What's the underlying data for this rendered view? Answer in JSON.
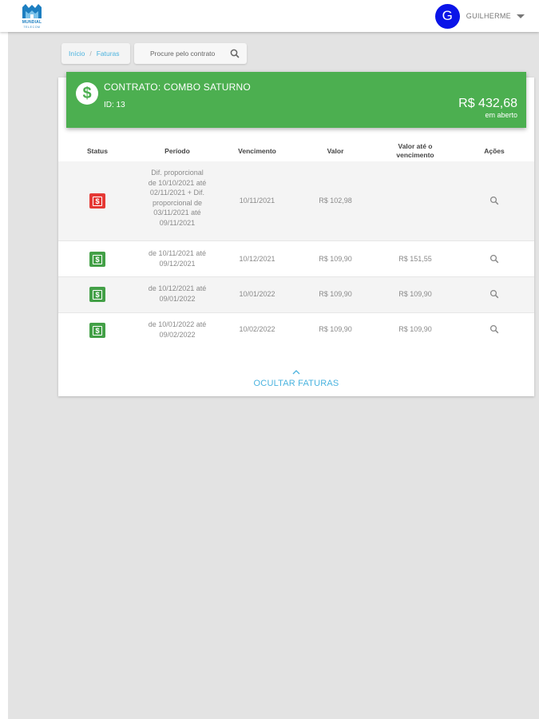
{
  "header": {
    "logo_text": "MUNDIAL",
    "logo_sub": "TELECOM",
    "user": {
      "initial": "G",
      "name": "GUILHERME"
    }
  },
  "breadcrumb": {
    "home": "Início",
    "separator": "/",
    "current": "Faturas"
  },
  "search": {
    "placeholder": "Procure pelo contrato"
  },
  "contract": {
    "title": "CONTRATO: COMBO SATURNO",
    "id": "ID: 13",
    "amount": "R$ 432,68",
    "amount_label": "em aberto"
  },
  "table": {
    "headers": {
      "status": "Status",
      "period": "Período",
      "due": "Vencimento",
      "value": "Valor",
      "value_due_1": "Valor até o",
      "value_due_2": "vencimento",
      "actions": "Ações"
    },
    "rows": [
      {
        "status": "overdue",
        "period_lines": [
          "Dif. proporcional",
          "de 10/10/2021 até",
          "02/11/2021 + Dif.",
          "proporcional de",
          "03/11/2021 até",
          "09/11/2021"
        ],
        "due": "10/11/2021",
        "value": "R$ 102,98",
        "value_due": ""
      },
      {
        "status": "open",
        "period_lines": [
          "de 10/11/2021 até",
          "09/12/2021"
        ],
        "due": "10/12/2021",
        "value": "R$ 109,90",
        "value_due": "R$ 151,55"
      },
      {
        "status": "open",
        "period_lines": [
          "de 10/12/2021 até",
          "09/01/2022"
        ],
        "due": "10/01/2022",
        "value": "R$ 109,90",
        "value_due": "R$ 109,90"
      },
      {
        "status": "open",
        "period_lines": [
          "de 10/01/2022 até",
          "09/02/2022"
        ],
        "due": "10/02/2022",
        "value": "R$ 109,90",
        "value_due": "R$ 109,90"
      }
    ]
  },
  "hide_invoices_label": "OCULTAR FATURAS",
  "colors": {
    "banner": "#4caf50",
    "status_open": "#43a047",
    "status_overdue": "#e53935",
    "link": "#4ab3df",
    "avatar": "#0a14e8"
  },
  "icons": {
    "status": "dollar-icon",
    "action": "magnifier-icon",
    "hide": "chevron-up-icon"
  }
}
